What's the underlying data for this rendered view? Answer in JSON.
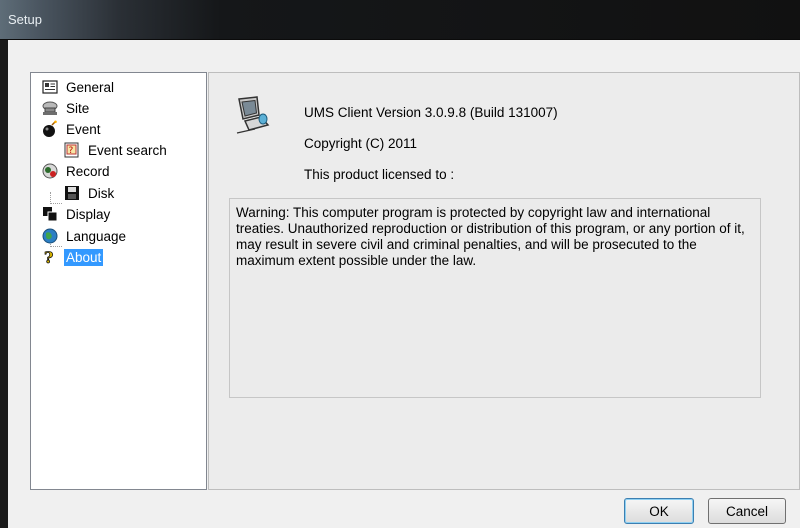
{
  "window": {
    "title": "Setup"
  },
  "tree": {
    "items": [
      {
        "label": "General",
        "icon": "general-card-icon"
      },
      {
        "label": "Site",
        "icon": "site-computer-icon"
      },
      {
        "label": "Event",
        "icon": "event-bomb-icon"
      },
      {
        "label": "Event search",
        "icon": "event-search-icon"
      },
      {
        "label": "Record",
        "icon": "record-icon"
      },
      {
        "label": "Disk",
        "icon": "disk-save-icon"
      },
      {
        "label": "Display",
        "icon": "display-windows-icon"
      },
      {
        "label": "Language",
        "icon": "language-globe-icon"
      },
      {
        "label": "About",
        "icon": "question-mark-icon"
      }
    ],
    "selected": "About"
  },
  "about": {
    "version": "UMS Client Version 3.0.9.8 (Build 131007)",
    "copyright": "Copyright (C) 2011",
    "licensed": "This product licensed to :",
    "warning": "Warning: This computer program is protected by copyright law and international treaties. Unauthorized reproduction or distribution of this program, or any portion of it, may result in severe civil and criminal penalties, and will be prosecuted to the maximum extent possible under the law."
  },
  "buttons": {
    "ok": "OK",
    "cancel": "Cancel"
  },
  "colors": {
    "selection": "#3399ff",
    "panel": "#ececec",
    "dialog": "#f0f0f0"
  }
}
